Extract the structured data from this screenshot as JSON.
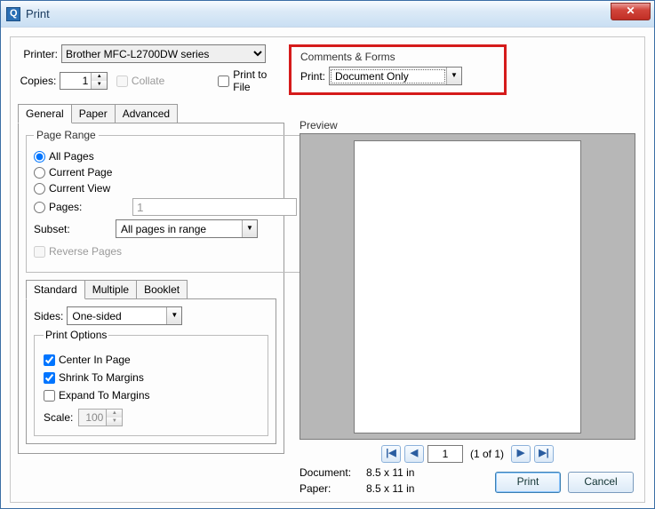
{
  "window": {
    "title": "Print"
  },
  "printer": {
    "label": "Printer:",
    "value": "Brother MFC-L2700DW series"
  },
  "copies": {
    "label": "Copies:",
    "value": "1"
  },
  "collate": {
    "label": "Collate"
  },
  "print_to_file": {
    "label": "Print to File"
  },
  "comments_forms": {
    "group_title": "Comments & Forms",
    "print_label": "Print:",
    "value": "Document Only"
  },
  "tabs_main": {
    "general": "General",
    "paper": "Paper",
    "advanced": "Advanced"
  },
  "page_range": {
    "legend": "Page Range",
    "all": "All Pages",
    "current_page": "Current Page",
    "current_view": "Current View",
    "pages": "Pages:",
    "pages_value": "1",
    "subset_label": "Subset:",
    "subset_value": "All pages in range",
    "reverse": "Reverse Pages"
  },
  "tabs_layout": {
    "standard": "Standard",
    "multiple": "Multiple",
    "booklet": "Booklet"
  },
  "sides": {
    "label": "Sides:",
    "value": "One-sided"
  },
  "print_options": {
    "legend": "Print Options",
    "center": "Center In Page",
    "shrink": "Shrink To Margins",
    "expand": "Expand To Margins",
    "scale_label": "Scale:",
    "scale_value": "100"
  },
  "preview": {
    "label": "Preview",
    "page_input": "1",
    "page_of": "(1 of 1)",
    "doc_label": "Document:",
    "doc_size": "8.5 x 11 in",
    "paper_label": "Paper:",
    "paper_size": "8.5 x 11 in"
  },
  "buttons": {
    "print": "Print",
    "cancel": "Cancel"
  }
}
